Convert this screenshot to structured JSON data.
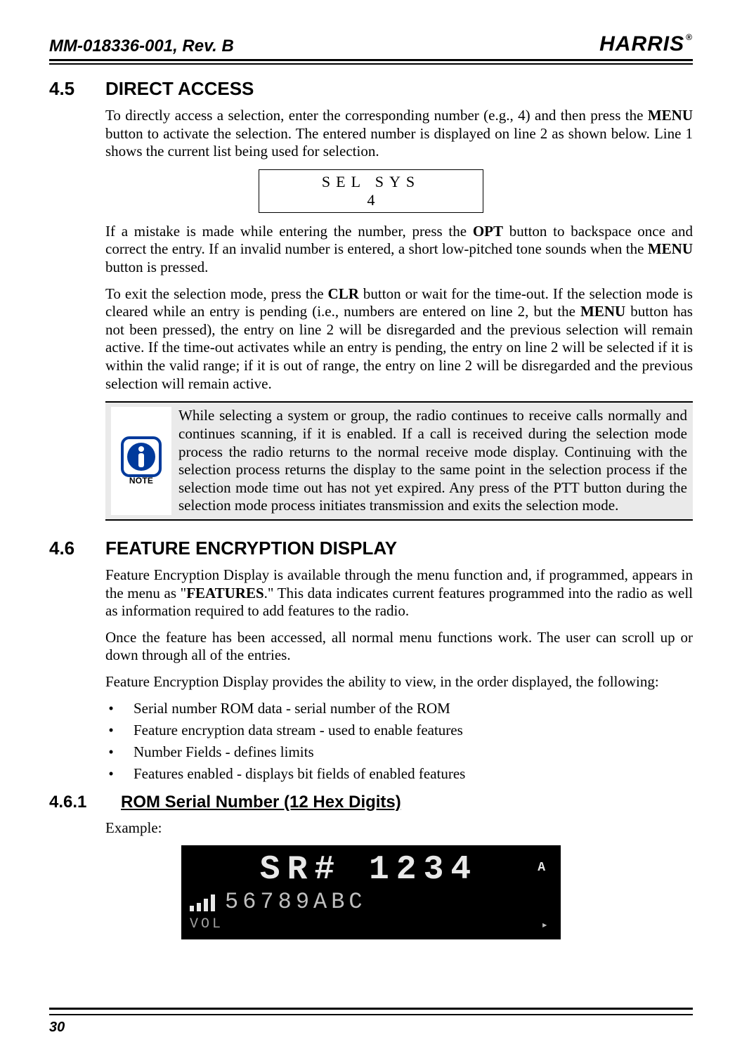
{
  "header": {
    "doc_id": "MM-018336-001, Rev. B",
    "brand": "HARRIS",
    "reg": "®"
  },
  "sec45": {
    "num": "4.5",
    "title": "DIRECT ACCESS",
    "p1_a": "To directly access a selection, enter the corresponding number (e.g., 4) and then press the ",
    "p1_menu": "MENU",
    "p1_b": " button to activate the selection. The entered number is displayed on line 2 as shown below. Line 1 shows the current list being used for selection.",
    "lcd_line1": "SEL SYS",
    "lcd_line2": "4",
    "p2_a": "If a mistake is made while entering the number, press the ",
    "p2_opt": "OPT",
    "p2_b": " button to backspace once and correct the entry. If an invalid number is entered, a short low-pitched tone sounds when the ",
    "p2_menu": "MENU",
    "p2_c": " button is pressed.",
    "p3_a": "To exit the selection mode, press the ",
    "p3_clr": "CLR",
    "p3_b": " button or wait for the time-out. If the selection mode is cleared while an entry is pending (i.e., numbers are entered on line 2, but the ",
    "p3_menu": "MENU",
    "p3_c": " button has not been pressed), the entry on line 2 will be disregarded and the previous selection will remain active. If the time-out activates while an entry is pending, the entry on line 2 will be selected if it is within the valid range; if it is out of range, the entry on line 2 will be disregarded and the previous selection will remain active."
  },
  "note": {
    "label": "NOTE",
    "text": "While selecting a system or group, the radio continues to receive calls normally and continues scanning, if it is enabled. If a call is received during the selection mode process the radio returns to the normal receive mode display. Continuing with the selection process returns the display to the same point in the selection process if the selection mode time out has not yet expired. Any press of the PTT button during the selection mode process initiates transmission and exits the selection mode."
  },
  "sec46": {
    "num": "4.6",
    "title": "FEATURE ENCRYPTION DISPLAY",
    "p1_a": "Feature Encryption Display is available through the menu function and, if programmed, appears in the menu as \"",
    "p1_feat": "FEATURES",
    "p1_b": ".\" This data indicates current features programmed into the radio as well as information required to add features to the radio.",
    "p2": "Once the feature has been accessed, all normal menu functions work. The user can scroll up or down through all of the entries.",
    "p3": "Feature Encryption Display provides the ability to view, in the order displayed, the following:",
    "bullets": [
      "Serial number ROM data - serial number of the ROM",
      "Feature encryption data stream - used to enable features",
      "Number Fields - defines limits",
      "Features enabled - displays bit fields of enabled features"
    ]
  },
  "sec461": {
    "num": "4.6.1",
    "title": "ROM Serial Number (12 Hex Digits)",
    "example_label": "Example:"
  },
  "lcd": {
    "row1": "SR# 1234",
    "row1_ind": "A",
    "row2": "56789ABC",
    "vol": "VOL",
    "arrow": "▸"
  },
  "page_number": "30"
}
